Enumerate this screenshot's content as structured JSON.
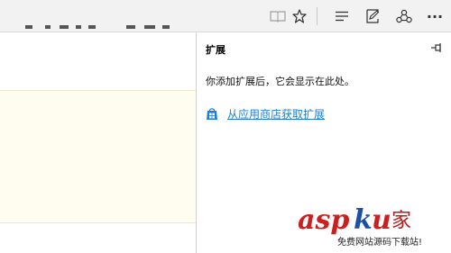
{
  "toolbar": {
    "buttons": [
      {
        "name": "reading-view",
        "icon": "book-icon"
      },
      {
        "name": "favorite",
        "icon": "star-icon"
      },
      {
        "name": "hub",
        "icon": "hub-lines-icon"
      },
      {
        "name": "web-note",
        "icon": "pen-note-icon"
      },
      {
        "name": "share",
        "icon": "share-icon"
      },
      {
        "name": "more",
        "icon": "more-dots-icon"
      }
    ],
    "more_label": "···"
  },
  "pane": {
    "title": "扩展",
    "message": "你添加扩展后，它会显示在此处。",
    "store_link_label": "从应用商店获取扩展"
  },
  "colors": {
    "toolbar_bg": "#f2f2f2",
    "link": "#1e7fd8",
    "cream": "#fffdf0"
  }
}
